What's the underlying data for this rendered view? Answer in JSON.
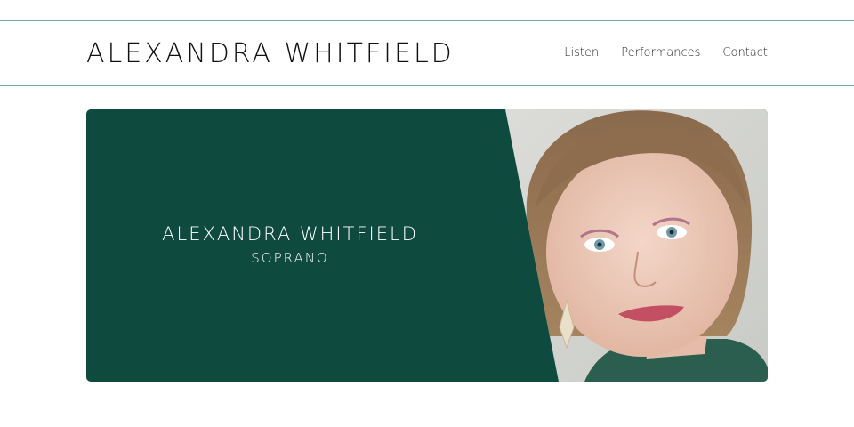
{
  "site": {
    "logo_text": "ALEXANDRA WHITFIELD"
  },
  "nav": {
    "items": [
      {
        "label": "Listen"
      },
      {
        "label": "Performances"
      },
      {
        "label": "Contact"
      }
    ]
  },
  "hero": {
    "name": "ALEXANDRA WHITFIELD",
    "subtitle": "SOPRANO",
    "background_color": "#0f4a3e",
    "photo": "portrait-photo"
  },
  "colors": {
    "header_rule": "#7fa6a0",
    "hero_green": "#0f4a3e"
  }
}
